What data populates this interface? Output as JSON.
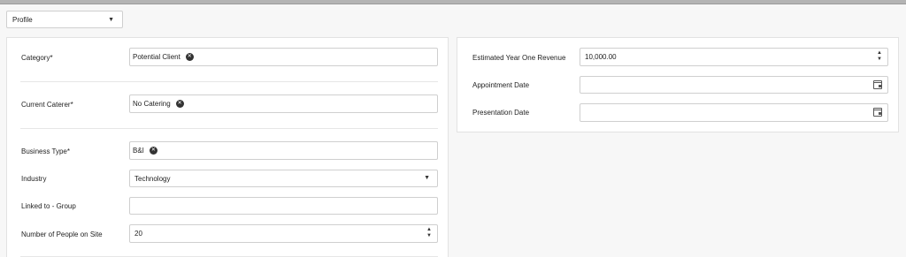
{
  "header": {
    "profile_select_value": "Profile"
  },
  "left": {
    "category": {
      "label": "Category*",
      "chip": "Potential Client"
    },
    "current_caterer": {
      "label": "Current Caterer*",
      "chip": "No Catering"
    },
    "business_type": {
      "label": "Business Type*",
      "chip": "B&I"
    },
    "industry": {
      "label": "Industry",
      "value": "Technology"
    },
    "linked_group": {
      "label": "Linked to - Group",
      "value": ""
    },
    "people_on_site": {
      "label": "Number of People on Site",
      "value": "20"
    }
  },
  "right": {
    "revenue": {
      "label": "Estimated Year One Revenue",
      "value": "10,000.00"
    },
    "appointment_date": {
      "label": "Appointment Date",
      "value": ""
    },
    "presentation_date": {
      "label": "Presentation Date",
      "value": ""
    }
  }
}
